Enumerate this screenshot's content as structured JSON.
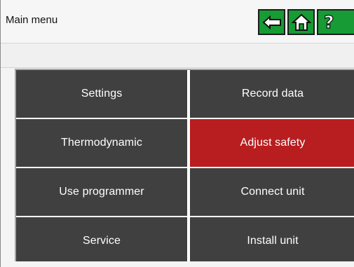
{
  "header": {
    "title": "Main menu",
    "back_icon": "arrow-left-icon",
    "home_icon": "home-icon",
    "help_icon": "question-mark-icon",
    "help_glyph": "?",
    "button_color": "#169b35"
  },
  "menu": {
    "items": [
      {
        "label": "Settings",
        "active": false
      },
      {
        "label": "Record data",
        "active": false
      },
      {
        "label": "Thermodynamic",
        "active": false
      },
      {
        "label": "Adjust safety",
        "active": true
      },
      {
        "label": "Use programmer",
        "active": false
      },
      {
        "label": "Connect unit",
        "active": false
      },
      {
        "label": "Service",
        "active": false
      },
      {
        "label": "Install unit",
        "active": false
      }
    ],
    "item_color": "#404040",
    "active_color": "#b81d1f",
    "text_color": "#ffffff"
  }
}
